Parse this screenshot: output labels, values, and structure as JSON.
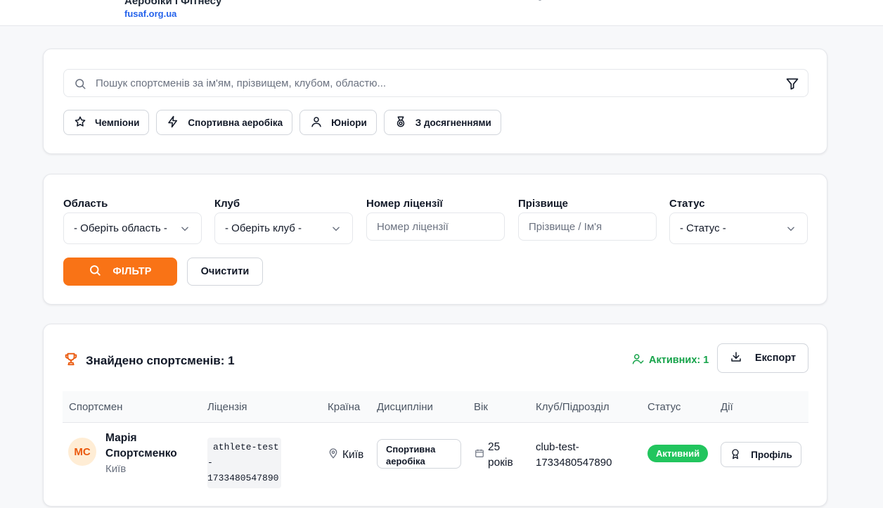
{
  "header": {
    "brand_name": "Аеробіки і Фітнесу",
    "brand_url": "fusaf.org.ua"
  },
  "search": {
    "placeholder": "Пошук спортсменів за ім'ям, прізвищем, клубом, областю...",
    "chips": [
      {
        "label": "Чемпіони",
        "icon": "star-icon"
      },
      {
        "label": "Спортивна аеробіка",
        "icon": "lightning-icon"
      },
      {
        "label": "Юніори",
        "icon": "user-icon"
      },
      {
        "label": "З досягненнями",
        "icon": "medal-icon"
      }
    ]
  },
  "filters": {
    "region": {
      "label": "Область",
      "value": "- Оберіть область -"
    },
    "club": {
      "label": "Клуб",
      "value": "- Оберіть клуб -"
    },
    "license": {
      "label": "Номер ліцензії",
      "placeholder": "Номер ліцензії"
    },
    "surname": {
      "label": "Прізвище",
      "placeholder": "Прізвище / Ім'я"
    },
    "status": {
      "label": "Статус",
      "value": "- Статус -"
    },
    "filter_button": "ФІЛЬТР",
    "clear_button": "Очистити"
  },
  "results": {
    "title": "Знайдено спортсменів: 1",
    "active_count": "Активних: 1",
    "export_button": "Експорт",
    "columns": [
      "Спортсмен",
      "Ліцензія",
      "Країна",
      "Дисципліни",
      "Вік",
      "Клуб/Підрозділ",
      "Статус",
      "Дії"
    ],
    "rows": [
      {
        "initials": "МС",
        "name": "Марія Спортсменко",
        "city": "Київ",
        "license_line1": "athlete-test-",
        "license_line2": "1733480547890",
        "country": "Київ",
        "discipline": "Спортивна аеробіка",
        "age": "25 років",
        "club": "club-test-1733480547890",
        "status": "Активний",
        "action": "Профіль"
      }
    ]
  },
  "colors": {
    "accent": "#f97316",
    "link": "#2563eb",
    "success": "#16a34a",
    "badge": "#22c55e"
  }
}
